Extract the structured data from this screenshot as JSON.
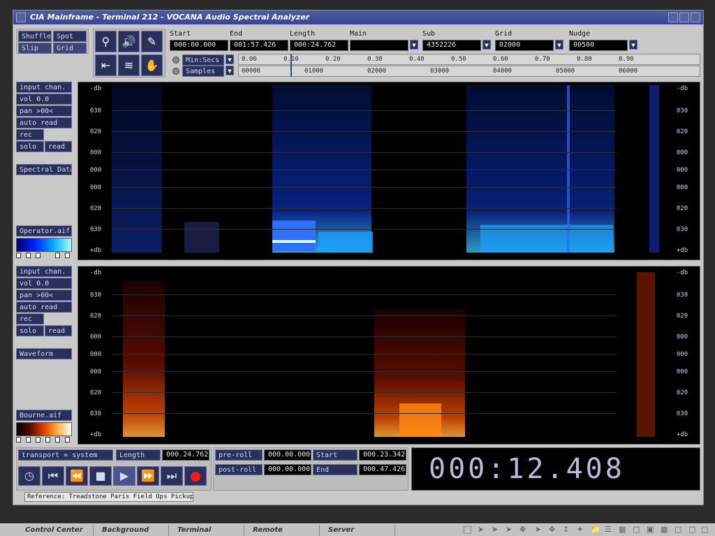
{
  "window": {
    "title": "CIA Mainframe - Terminal 212 - VOCANA Audio Spectral Analyzer"
  },
  "modes": {
    "shuffle": "Shuffle",
    "spot": "Spot",
    "slip": "Slip",
    "grid": "Grid"
  },
  "tools": [
    "zoom-icon",
    "speaker-icon",
    "pencil-icon",
    "trim-icon",
    "scrub-icon",
    "hand-icon"
  ],
  "counters": {
    "start_label": "Start",
    "start": "000:00.000",
    "end_label": "End",
    "end": "001:57.426",
    "length_label": "Length",
    "length": "000:24.762",
    "main_label": "Main",
    "main": "",
    "sub_label": "Sub",
    "sub": "4352226",
    "grid_label": "Grid",
    "grid": "02000",
    "nudge_label": "Nudge",
    "nudge": "00500"
  },
  "rulers": {
    "minsecs_label": "Min:Secs",
    "samples_label": "Samples",
    "minsecs_ticks": [
      "0.00",
      "0.10",
      "0.20",
      "0.30",
      "0.40",
      "0.50",
      "0.60",
      "0.70",
      "0.80",
      "0.90"
    ],
    "samples_ticks": [
      "00000",
      "01000",
      "02000",
      "03000",
      "04000",
      "05000",
      "06000"
    ]
  },
  "track1": {
    "input": "input chan.",
    "vol": "vol  0.0",
    "pan": "pan >00<",
    "auto": "auto read",
    "rec": "rec",
    "solo": "solo",
    "read": "read",
    "view": "Spectral Data",
    "file": "Operator.aif",
    "ylabels": [
      "-db",
      "030",
      "020",
      "000",
      "000",
      "000",
      "020",
      "030",
      "+db"
    ]
  },
  "track2": {
    "input": "input chan.",
    "vol": "vol  0.0",
    "pan": "pan >00<",
    "auto": "auto read",
    "rec": "rec",
    "solo": "solo",
    "read": "read",
    "view": "Waveform",
    "file": "Bourne.aif",
    "ylabels": [
      "-db",
      "030",
      "020",
      "000",
      "000",
      "000",
      "020",
      "030",
      "+db"
    ]
  },
  "transport": {
    "mode": "transport = system",
    "length_label": "Length",
    "length": "000.24.762",
    "preroll_label": "pre-roll",
    "preroll": "000.00.000",
    "postroll_label": "post-roll",
    "postroll": "000.00.000",
    "start_label": "Start",
    "start": "000.23.342",
    "end_label": "End",
    "end": "000.47.426",
    "big_counter": "000:12.408"
  },
  "status": {
    "reference": "Reference: Treadstone Paris Field Ops Pickup"
  },
  "taskbar": [
    "Control Center",
    "Background",
    "Terminal",
    "Remote",
    "Server"
  ],
  "colors": {
    "accent": "#2a2f5c",
    "title": "#3a468a",
    "spectral": "#1e4dff",
    "waveform": "#ff6a00"
  }
}
